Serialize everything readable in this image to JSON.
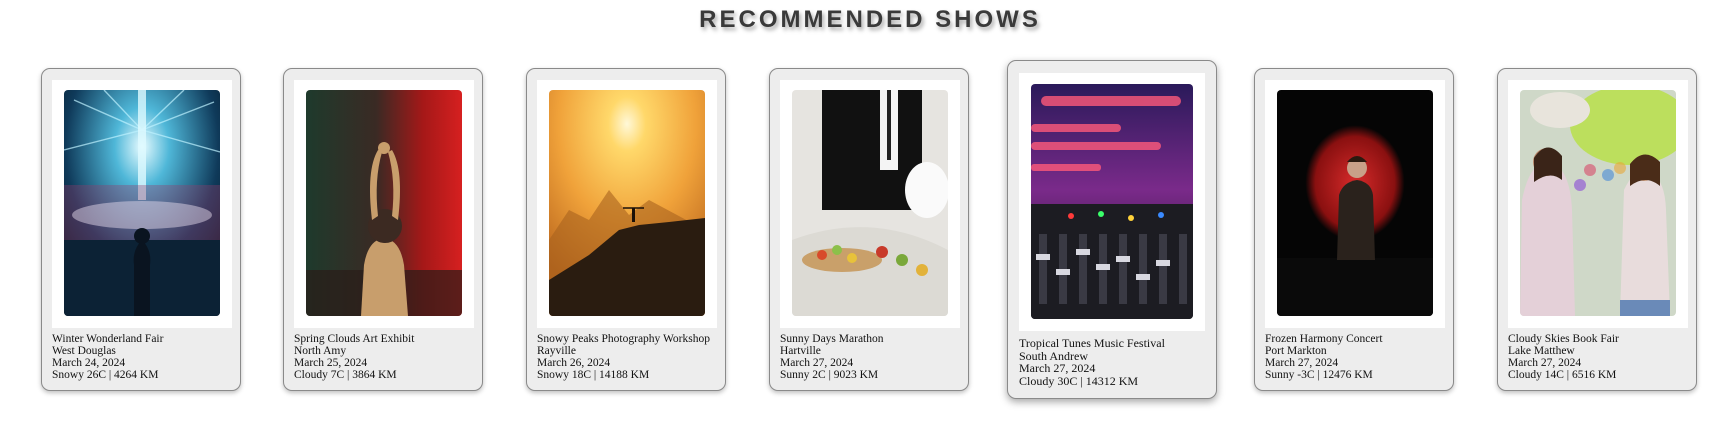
{
  "page": {
    "title": "RECOMMENDED SHOWS"
  },
  "shows": [
    {
      "name": "Winter Wonderland Fair",
      "location": "West Douglas",
      "date": "March 24, 2024",
      "weather_distance": "Snowy 26C | 4264 KM",
      "image": "concert-stage-lights"
    },
    {
      "name": "Spring Clouds Art Exhibit",
      "location": "North Amy",
      "date": "March 25, 2024",
      "weather_distance": "Cloudy 7C | 3864 KM",
      "image": "dj-red-smoke"
    },
    {
      "name": "Snowy Peaks Photography Workshop",
      "location": "Rayville",
      "date": "March 26, 2024",
      "weather_distance": "Snowy 18C | 14188 KM",
      "image": "sunset-mountain-figure"
    },
    {
      "name": "Sunny Days Marathon",
      "location": "Hartville",
      "date": "March 27, 2024",
      "weather_distance": "Sunny 2C | 9023 KM",
      "image": "catering-buffet"
    },
    {
      "name": "Tropical Tunes Music Festival",
      "location": "South Andrew",
      "date": "March 27, 2024",
      "weather_distance": "Cloudy 30C | 14312 KM",
      "image": "mixing-console"
    },
    {
      "name": "Frozen Harmony Concert",
      "location": "Port Markton",
      "date": "March 27, 2024",
      "weather_distance": "Sunny -3C | 12476 KM",
      "image": "spotlight-singer"
    },
    {
      "name": "Cloudy Skies Book Fair",
      "location": "Lake Matthew",
      "date": "March 27, 2024",
      "weather_distance": "Cloudy 14C | 6516 KM",
      "image": "color-festival"
    }
  ]
}
